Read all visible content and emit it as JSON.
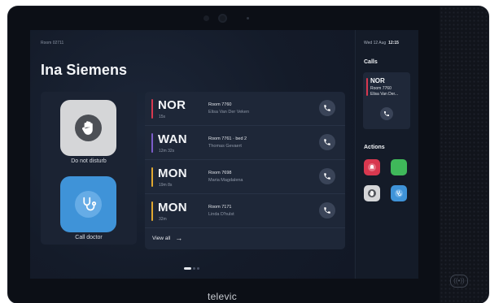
{
  "header": {
    "room": "Room 02711",
    "date": "Wed 12 Aug",
    "time": "12:15"
  },
  "patient": {
    "name": "Ina Siemens"
  },
  "quick_actions": [
    {
      "label": "Do not disturb",
      "icon": "hand-icon",
      "color": "#d5d6d8"
    },
    {
      "label": "Call doctor",
      "icon": "stethoscope-icon",
      "color": "#3f93d8"
    }
  ],
  "call_list": {
    "rows": [
      {
        "code": "NOR",
        "duration": "15s",
        "room": "Room 7760",
        "person": "Elisa Van Der Veken",
        "color": "#d8384f"
      },
      {
        "code": "WAN",
        "duration": "12m 32s",
        "room": "Room 7761 · bed 2",
        "person": "Thomas Gevaert",
        "color": "#7b5cc9"
      },
      {
        "code": "MON",
        "duration": "19m 8s",
        "room": "Room 7698",
        "person": "Maria Magdalena",
        "color": "#e0a830"
      },
      {
        "code": "MON",
        "duration": "32m",
        "room": "Room 7171",
        "person": "Linda D'hulst",
        "color": "#e0a830"
      }
    ],
    "view_all": "View all"
  },
  "pagination": {
    "pages": 3,
    "current": 1
  },
  "sidebar": {
    "calls_title": "Calls",
    "mini_call": {
      "code": "NOR",
      "room": "Room 7760",
      "person": "Elisa Van Der..."
    },
    "actions_title": "Actions",
    "actions": [
      {
        "icon": "alarm-icon",
        "color": "#d8384f"
      },
      {
        "icon": "blank-icon",
        "color": "#3fb85a"
      },
      {
        "icon": "hand-icon",
        "color": "#d5d6d8"
      },
      {
        "icon": "stethoscope-icon",
        "color": "#3f93d8"
      }
    ]
  },
  "brand": "televic"
}
